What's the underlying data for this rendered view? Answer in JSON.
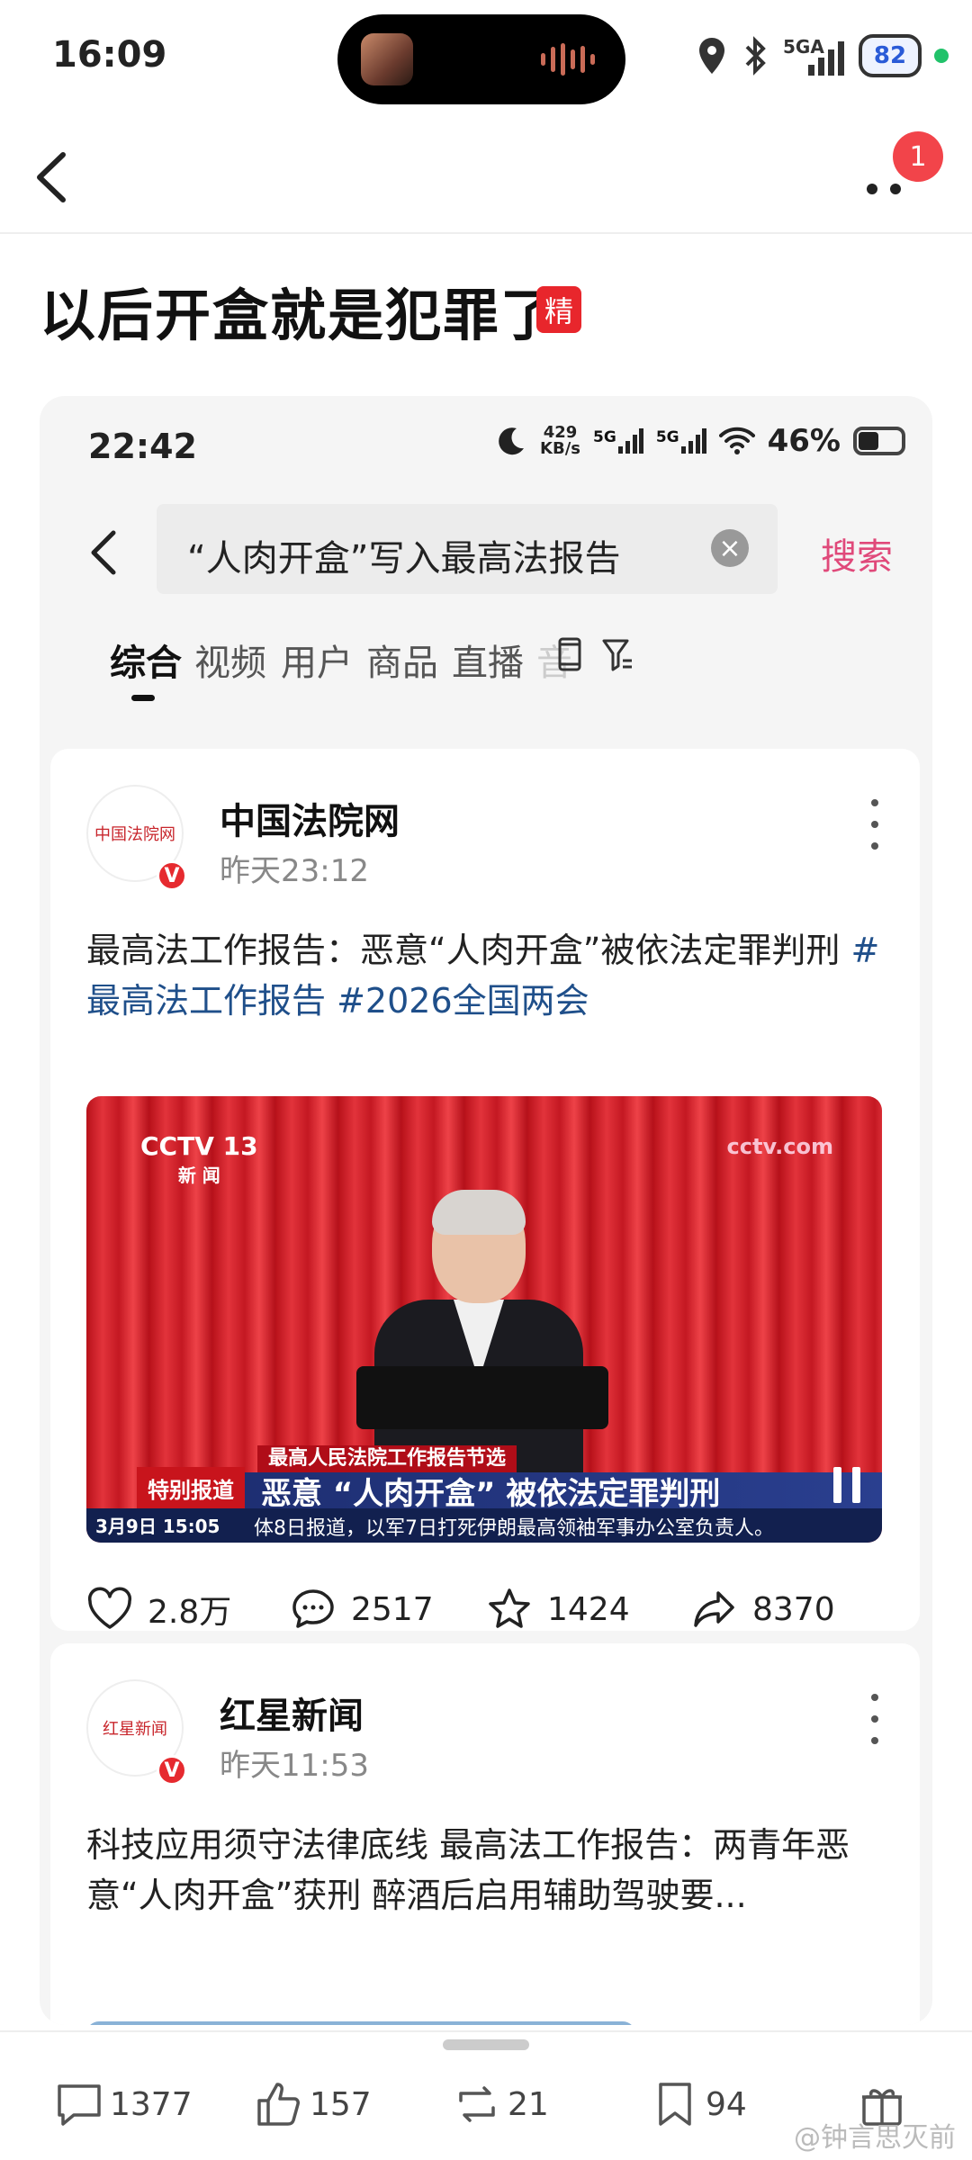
{
  "status": {
    "time": "16:09",
    "network": "5GA",
    "battery": "82"
  },
  "nav": {
    "notification_count": "1"
  },
  "post": {
    "title": "以后开盒就是犯罪了",
    "badge": "精"
  },
  "inner": {
    "status": {
      "time": "22:42",
      "speed_value": "429",
      "speed_unit": "KB/s",
      "sim1": "5G",
      "sim2": "5G",
      "battery": "46%"
    },
    "search": {
      "query": "“人肉开盒”写入最高法报告",
      "button": "搜索"
    },
    "tabs": [
      "综合",
      "视频",
      "用户",
      "商品",
      "直播",
      "音"
    ],
    "posts": [
      {
        "author": "中国法院网",
        "time": "昨天23:12",
        "logo_text": "中国法院网",
        "text": "最高法工作报告：恶意“人肉开盒”被依法定罪判刑 ",
        "tags": "#最高法工作报告 #2026全国两会",
        "video": {
          "channel": "CCTV 13",
          "channel_sub": "新 闻",
          "site": "cctv.com",
          "caption_top": "最高人民法院工作报告节选",
          "label": "特别报道",
          "caption_main": "恶意 “人肉开盒” 被依法定罪判刑",
          "date": "3月9日 15:05",
          "ticker": "体8日报道，以军7日打死伊朗最高领袖军事办公室负责人。"
        },
        "likes": "2.8万",
        "comments": "2517",
        "favorites": "1424",
        "shares": "8370"
      },
      {
        "author": "红星新闻",
        "time": "昨天11:53",
        "logo_text": "红星新闻",
        "text": "科技应用须守法律底线 最高法工作报告：两青年恶意“人肉开盒”获刑 醉酒后启用辅助驾驶要..."
      }
    ]
  },
  "bottom": {
    "comments": "1377",
    "likes": "157",
    "reposts": "21",
    "favorites": "94",
    "watermark": "@钟言思灭前"
  },
  "colors": {
    "accent": "#e0497a",
    "badge_red": "#e8262c",
    "tag_blue": "#1f4f8a"
  }
}
